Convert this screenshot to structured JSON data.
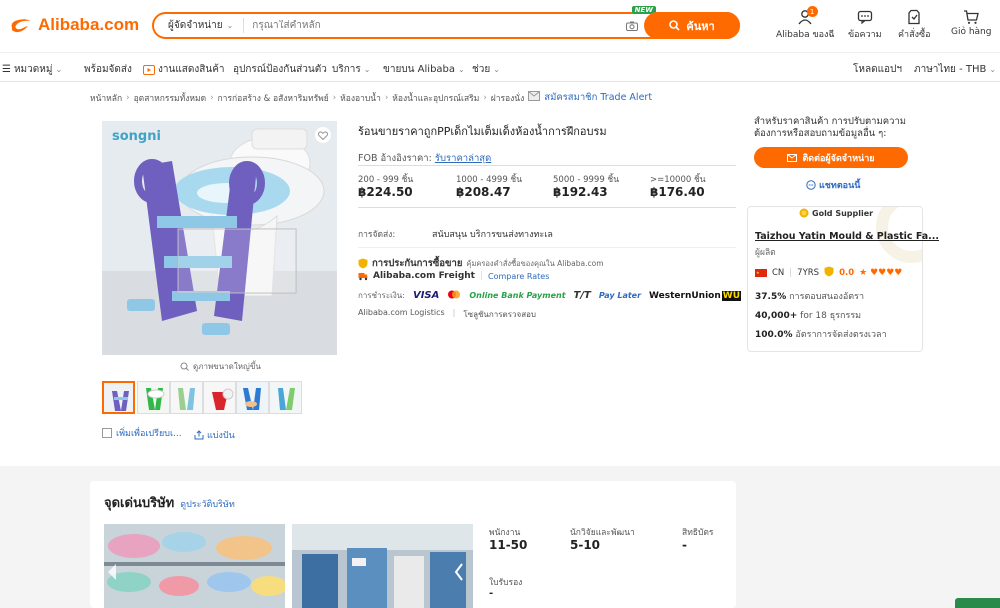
{
  "header": {
    "logo_text": "Alibaba.com",
    "search_category": "ผู้จัดจำหน่าย",
    "search_placeholder": "กรุณาใส่คำหลัก",
    "new_badge": "NEW",
    "search_button": "ค้นหา",
    "items": [
      {
        "label": "Alibaba ของฉี",
        "icon": "user-icon",
        "badge": "1"
      },
      {
        "label": "ข้อความ",
        "icon": "message-icon"
      },
      {
        "label": "คำสั่งซื้อ",
        "icon": "orders-icon"
      },
      {
        "label": "Giỏ hàng",
        "icon": "cart-icon"
      }
    ]
  },
  "nav": {
    "categories": "หมวดหมู่",
    "ready": "พร้อมจัดส่ง",
    "live": "งานแสดงสินค้า",
    "protection": "อุปกรณ์ป้องกันส่วนตัว",
    "services": "บริการ",
    "sell": "ขายบน Alibaba",
    "help": "ช่วย",
    "download": "โหลดแอปฯ",
    "language": "ภาษาไทย - THB"
  },
  "breadcrumb": {
    "items": [
      "หน้าหลัก",
      "อุตสาหกรรมทั้งหมด",
      "การก่อสร้าง & อสังหาริมทรัพย์",
      "ห้องอาบน้ำ",
      "ห้องน้ำและอุปกรณ์เสริม",
      "ฝารองนั่ง"
    ],
    "trade_alert": "สมัครสมาชิก Trade Alert"
  },
  "product": {
    "title": "ร้อนขายราคาถูกPPเด็กไมเต็มเด็งห้องน้ำการฝึกอบรม",
    "brand_overlay": "songni",
    "fob_label": "FOB อ้างอิงราคา:",
    "fob_link": "รับราคาล่าสุด",
    "tiers": [
      {
        "qty": "200 - 999 ชิ้น",
        "price": "฿224.50"
      },
      {
        "qty": "1000 - 4999 ชิ้น",
        "price": "฿208.47"
      },
      {
        "qty": "5000 - 9999 ชิ้น",
        "price": "฿192.43"
      },
      {
        "qty": ">=10000 ชิ้น",
        "price": "฿176.40"
      }
    ],
    "shipping_label": "การจัดส่ง:",
    "shipping_value": "สนับสนุน บริการขนส่งทางทะเล",
    "protection_title": "การประกันการซื้อขาย",
    "protection_sub": "คุ้มครองคำสั่งซื้อของคุณใน Alibaba.com",
    "freight": "Alibaba.com Freight",
    "compare_rates": "Compare Rates",
    "payment_label": "การชำระเงิน:",
    "payments": [
      "VISA",
      "Online Bank Payment",
      "T/T",
      "Pay Later",
      "WesternUnion",
      "WU"
    ],
    "logistics": [
      "Alibaba.com Logistics",
      "โซลูชันการตรวจสอบ"
    ],
    "zoom_label": "ดูภาพขนาดใหญ่ขึ้น",
    "compare_label": "เพิ่มเพื่อเปรียบเ...",
    "share_label": "แบ่งปัน"
  },
  "supplier": {
    "question": "สำหรับราคาสินค้า การปรับตามความต้องการหรือสอบถามข้อมูลอื่น ๆ:",
    "contact_button": "ติดต่อผู้จัดจำหน่าย",
    "chat": "แชทตอนนี้",
    "gold": "Gold Supplier",
    "name": "Taizhou Yatin Mould & Plastic Fa...",
    "type": "ผู้ผลิต",
    "country": "CN",
    "years": "7YRS",
    "rating": "0.0",
    "stats": [
      {
        "value": "37.5%",
        "label": "การตอบสนองอัตรา"
      },
      {
        "value": "40,000+",
        "label": "for 18 ธุรกรรม"
      },
      {
        "value": "100.0%",
        "label": "อัตราการจัดส่งตรงเวลา"
      }
    ]
  },
  "company": {
    "title": "จุดเด่นบริษัท",
    "profile_link": "ดูประวัติบริษัท",
    "facts": [
      {
        "label": "พนักงาน",
        "value": "11-50"
      },
      {
        "label": "นักวิจัยและพัฒนา",
        "value": "5-10"
      },
      {
        "label": "สิทธิบัตร",
        "value": "-"
      },
      {
        "label": "ใบรับรอง",
        "value": "-"
      }
    ]
  },
  "colors": {
    "accent": "#ff6a00",
    "link": "#2e6bbf",
    "gold": "#f0b400"
  }
}
